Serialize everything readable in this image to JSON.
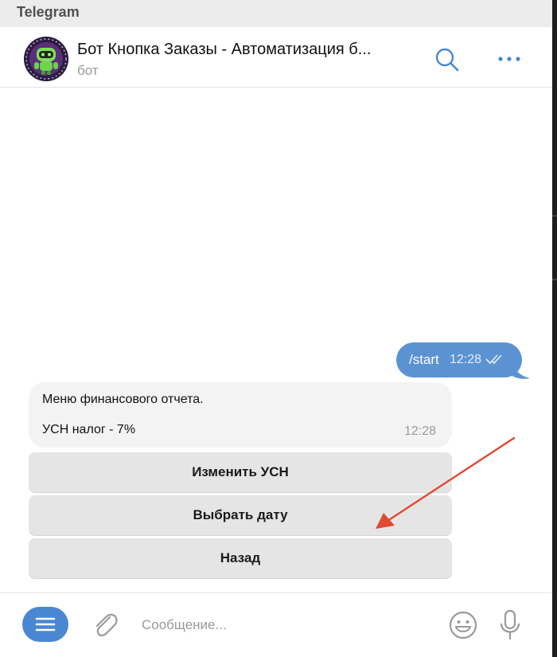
{
  "app": {
    "title": "Telegram"
  },
  "chat": {
    "title": "Бот Кнопка Заказы - Автоматизация б...",
    "subtitle": "бот"
  },
  "messages": {
    "outgoing": {
      "text": "/start",
      "time": "12:28"
    },
    "incoming": {
      "line1": "Меню финансового отчета.",
      "line2": "УСН налог - 7%",
      "time": "12:28"
    }
  },
  "keyboard": {
    "buttons": [
      "Изменить УСН",
      "Выбрать дату",
      "Назад"
    ]
  },
  "composer": {
    "placeholder": "Сообщение..."
  },
  "colors": {
    "accent": "#4a87d3",
    "outgoing_bubble": "#5b93d2",
    "incoming_bubble": "#f3f3f3",
    "keyboard_button": "#e5e5e5",
    "annotation_arrow": "#e04a32"
  },
  "icons": {
    "header": [
      "search-icon",
      "more-icon"
    ],
    "composer": [
      "menu-icon",
      "attach-icon",
      "emoji-icon",
      "mic-icon"
    ],
    "message": [
      "double-check-icon"
    ]
  }
}
